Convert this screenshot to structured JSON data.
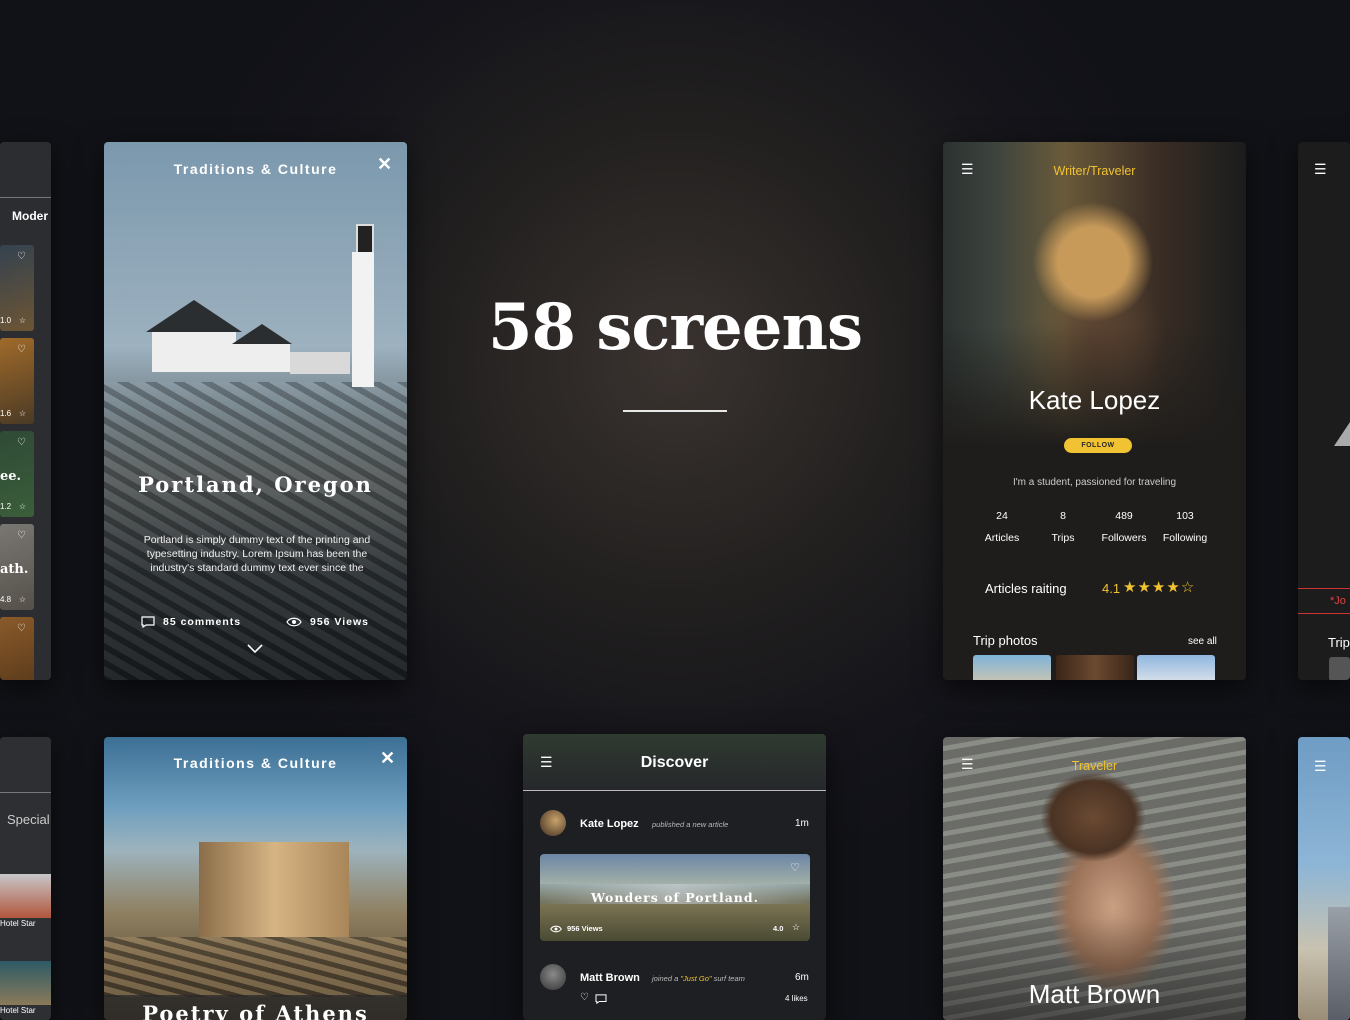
{
  "hero": {
    "title": "58 screens"
  },
  "portland": {
    "category": "Traditions & Culture",
    "title": "Portland, Oregon",
    "description": "Portland is simply dummy text of the printing and typesetting industry. Lorem Ipsum has been the industry's standard dummy text ever since the",
    "comments": "85 comments",
    "views": "956 Views"
  },
  "left_partial": {
    "heading": "Moder",
    "items": [
      {
        "value": "1.0",
        "text": ""
      },
      {
        "value": "1.6",
        "text": ""
      },
      {
        "value": "1.2",
        "text": "ee."
      },
      {
        "value": "4.8",
        "text": "ath."
      }
    ],
    "bottom_heading": "Special",
    "bottom_items": [
      "Hotel Star",
      "Hotel Star"
    ]
  },
  "kate": {
    "role": "Writer/Traveler",
    "name": "Kate Lopez",
    "follow": "FOLLOW",
    "bio": "I'm a student, passioned for traveling",
    "stats": [
      {
        "n": "24",
        "label": "Articles"
      },
      {
        "n": "8",
        "label": "Trips"
      },
      {
        "n": "489",
        "label": "Followers"
      },
      {
        "n": "103",
        "label": "Following"
      }
    ],
    "rating_label": "Articles raiting",
    "rating_value": "4.1",
    "rating_stars": 4.1,
    "trip_photos": "Trip photos",
    "see_all": "see all"
  },
  "right_partial": {
    "tag": "*Jo",
    "heading": "Trip"
  },
  "athens": {
    "category": "Traditions & Culture",
    "title": "Poetry of Athens"
  },
  "discover": {
    "title": "Discover",
    "feed": [
      {
        "name": "Kate Lopez",
        "action": "published a new article",
        "time": "1m"
      },
      {
        "name": "Matt Brown",
        "action_pre": "joined a ",
        "action_highlight": "\"Just Go\"",
        "action_post": " surf team",
        "time": "6m",
        "likes": "4 likes"
      }
    ],
    "article": {
      "title": "Wonders of Portland.",
      "views": "956 Views",
      "rating": "4.0"
    }
  },
  "matt": {
    "role": "Traveler",
    "name": "Matt Brown"
  },
  "colors": {
    "accent": "#f1c232",
    "background": "#14141a"
  }
}
